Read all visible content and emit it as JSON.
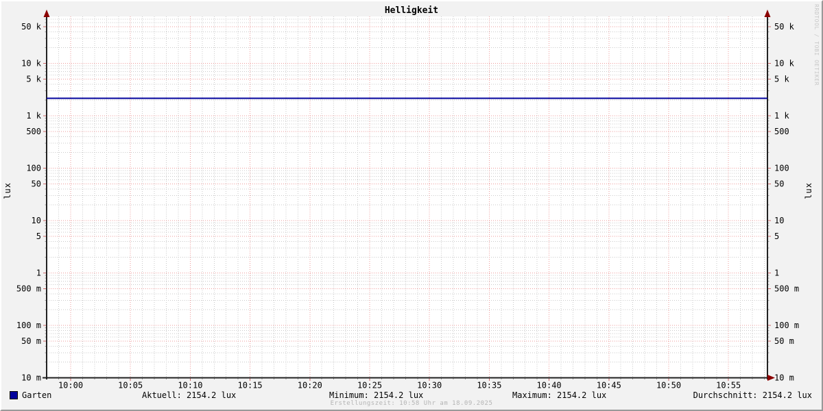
{
  "chart_data": {
    "type": "line",
    "title": "Helligkeit",
    "ylabel_left": "lux",
    "ylabel_right": "lux",
    "watermark": "RRDTOOL / TOBI OETIKER",
    "y_scale": "log",
    "ylim": [
      0.01,
      78000
    ],
    "x_start": "09:58",
    "x_end": "10:58",
    "y_ticks": [
      {
        "value": 50000,
        "label": "50 k"
      },
      {
        "value": 10000,
        "label": "10 k"
      },
      {
        "value": 5000,
        "label": "5 k"
      },
      {
        "value": 1000,
        "label": "1 k"
      },
      {
        "value": 500,
        "label": "500"
      },
      {
        "value": 100,
        "label": "100"
      },
      {
        "value": 50,
        "label": "50"
      },
      {
        "value": 10,
        "label": "10"
      },
      {
        "value": 5,
        "label": "5"
      },
      {
        "value": 1,
        "label": "1"
      },
      {
        "value": 0.5,
        "label": "500 m"
      },
      {
        "value": 0.1,
        "label": "100 m"
      },
      {
        "value": 0.05,
        "label": "50 m"
      },
      {
        "value": 0.01,
        "label": "10 m"
      }
    ],
    "x_ticks": [
      "10:00",
      "10:05",
      "10:10",
      "10:15",
      "10:20",
      "10:25",
      "10:30",
      "10:35",
      "10:40",
      "10:45",
      "10:50",
      "10:55"
    ],
    "series": [
      {
        "name": "Garten",
        "color": "#00009c",
        "value": 2154.2,
        "unit": "lux"
      }
    ],
    "stats": {
      "aktuell": "Aktuell: 2154.2 lux",
      "minimum": "Minimum: 2154.2 lux",
      "maximum": "Maximum: 2154.2 lux",
      "durchschnitt": "Durchschnitt: 2154.2 lux"
    },
    "footer": "Erstellungszeit: 10:58 Uhr am 18.09.2025",
    "colors": {
      "canvas": "#ffffff",
      "background": "#f2f2f2",
      "grid_major": "#ee9999",
      "grid_minor": "#c9c9c9",
      "axis": "#222222",
      "arrow": "#8b0000",
      "tick_major": "#cc6666",
      "tick_minor": "#999999"
    }
  }
}
